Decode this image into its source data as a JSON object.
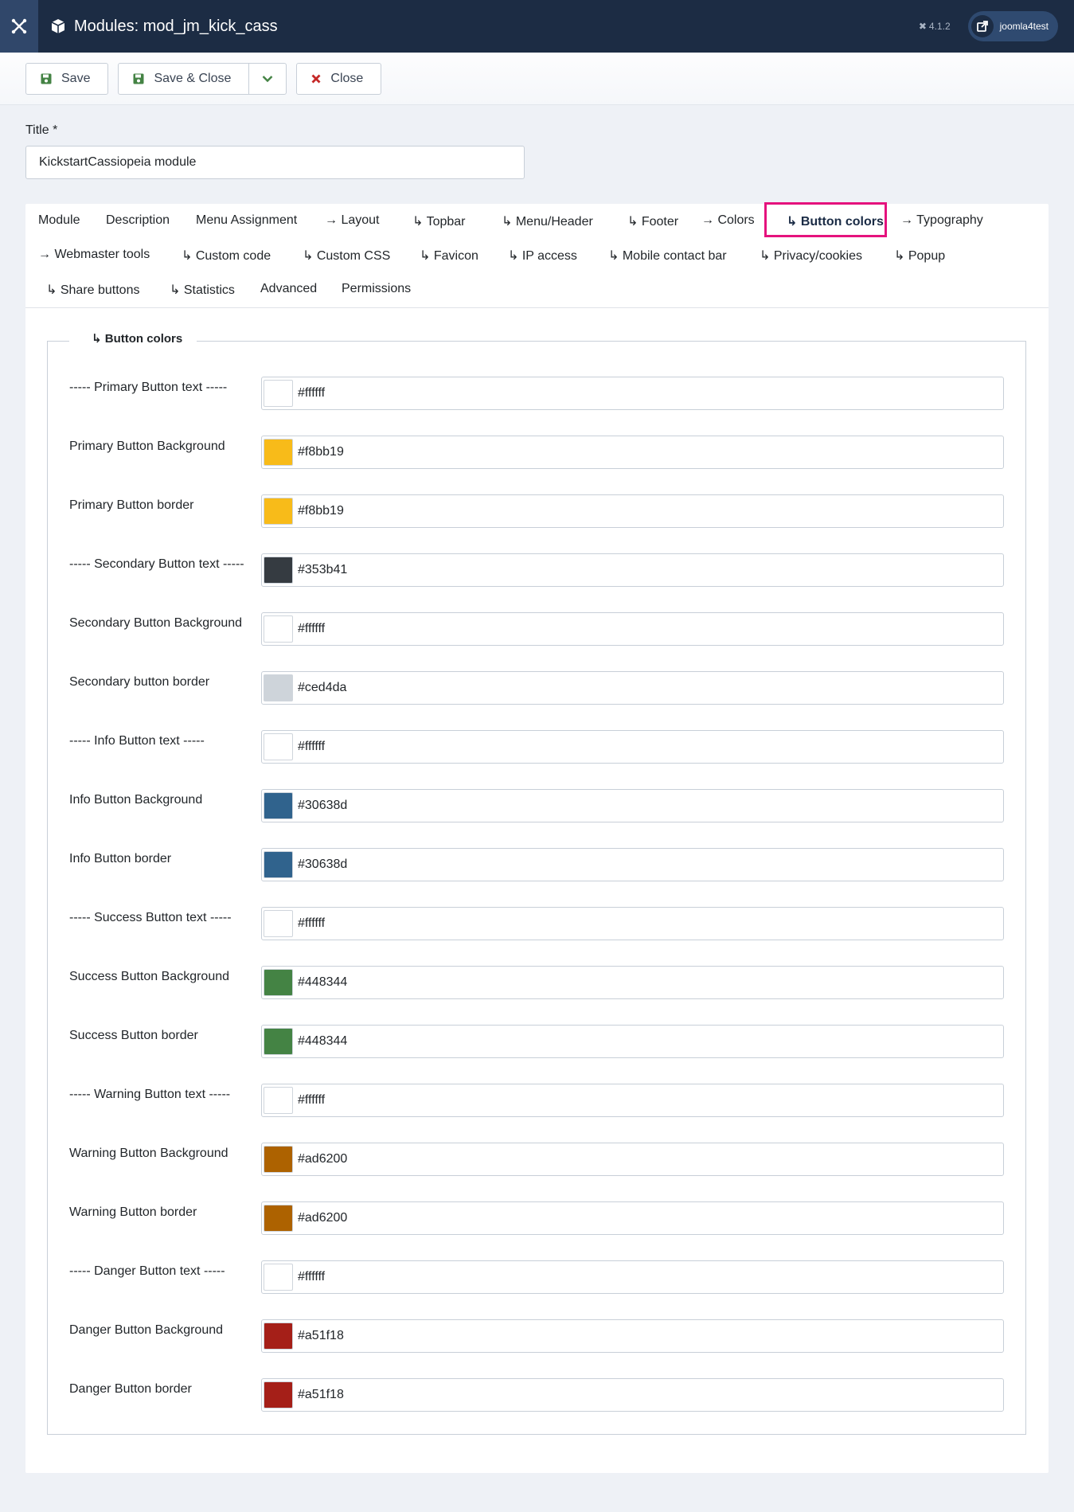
{
  "header": {
    "title": "Modules: mod_jm_kick_cass",
    "version": "4.1.2",
    "user": "joomla4test"
  },
  "toolbar": {
    "save_label": "Save",
    "save_close_label": "Save & Close",
    "close_label": "Close"
  },
  "title_field": {
    "label": "Title *",
    "value": "KickstartCassiopeia module"
  },
  "tabs": [
    "Module",
    "Description",
    "Menu Assignment",
    "→ Layout",
    "↳ Topbar",
    "↳ Menu/Header",
    "↳ Footer",
    "→ Colors",
    "↳ Button colors",
    "→ Typography",
    "→ Webmaster tools",
    "↳ Custom code",
    "↳ Custom CSS",
    "↳ Favicon",
    "↳ IP access",
    "↳ Mobile contact bar",
    "↳ Privacy/cookies",
    "↳ Popup",
    "↳ Share buttons",
    "↳ Statistics",
    "Advanced",
    "Permissions"
  ],
  "active_tab": "↳ Button colors",
  "fieldset": {
    "legend": "↳ Button colors",
    "fields": [
      {
        "label": "----- Primary Button text -----",
        "value": "#ffffff"
      },
      {
        "label": "Primary Button Background",
        "value": "#f8bb19"
      },
      {
        "label": "Primary Button border",
        "value": "#f8bb19"
      },
      {
        "label": "----- Secondary Button text -----",
        "value": "#353b41"
      },
      {
        "label": "Secondary Button Background",
        "value": "#ffffff"
      },
      {
        "label": "Secondary button border",
        "value": "#ced4da"
      },
      {
        "label": "----- Info Button text -----",
        "value": "#ffffff"
      },
      {
        "label": "Info Button Background",
        "value": "#30638d"
      },
      {
        "label": "Info Button border",
        "value": "#30638d"
      },
      {
        "label": "----- Success Button text -----",
        "value": "#ffffff"
      },
      {
        "label": "Success Button Background",
        "value": "#448344"
      },
      {
        "label": "Success Button border",
        "value": "#448344"
      },
      {
        "label": "----- Warning Button text -----",
        "value": "#ffffff"
      },
      {
        "label": "Warning Button Background",
        "value": "#ad6200"
      },
      {
        "label": "Warning Button border",
        "value": "#ad6200"
      },
      {
        "label": "----- Danger Button text -----",
        "value": "#ffffff"
      },
      {
        "label": "Danger Button Background",
        "value": "#a51f18"
      },
      {
        "label": "Danger Button border",
        "value": "#a51f18"
      }
    ]
  },
  "colors": {
    "header_bg": "#1c2c44",
    "active_tab_highlight": "#e5127d",
    "close_icon": "#c52827",
    "save_icon": "#448344"
  }
}
